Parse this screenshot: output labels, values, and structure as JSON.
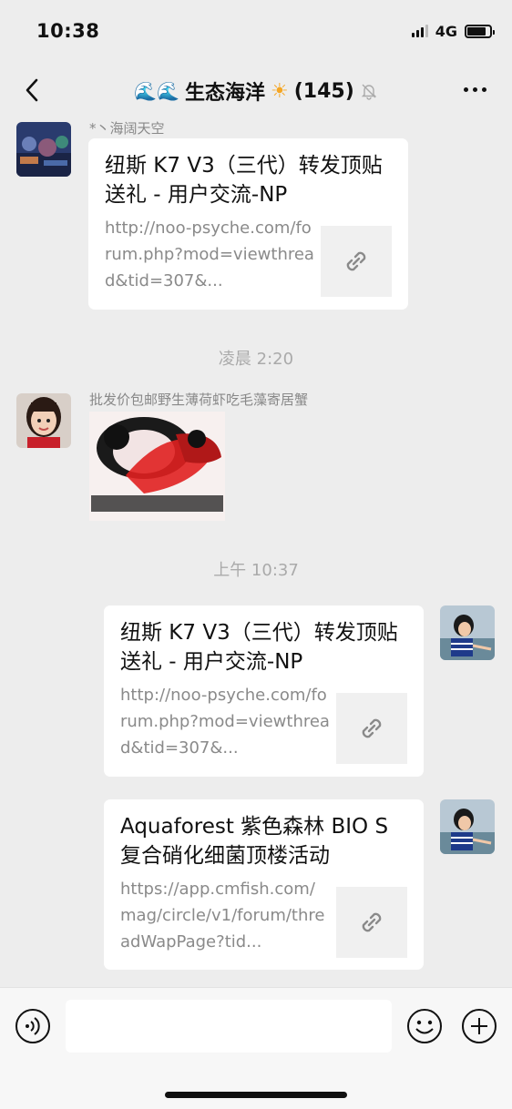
{
  "status": {
    "time": "10:38",
    "network": "4G",
    "battery_level": 0.85
  },
  "header": {
    "title_prefix": "🌊🌊",
    "title": "生态海洋",
    "title_suffix": "☀",
    "member_count": "(145)"
  },
  "messages": [
    {
      "sender": "*丶海阔天空",
      "card_title": "纽斯 K7 V3（三代）转发顶贴送礼 - 用户交流-NP",
      "card_desc": "http://noo-psyche.com/forum.php?mod=viewthread&tid=307&..."
    },
    {
      "timestamp": "凌晨 2:20"
    },
    {
      "sender": "批发价包邮野生薄荷虾吃毛藻寄居蟹"
    },
    {
      "timestamp": "上午 10:37"
    },
    {
      "card_title": "纽斯 K7 V3（三代）转发顶贴送礼 - 用户交流-NP",
      "card_desc": "http://noo-psyche.com/forum.php?mod=viewthread&tid=307&..."
    },
    {
      "card_title": "Aquaforest 紫色森林 BIO S 复合硝化细菌顶楼活动",
      "card_desc": "https://app.cmfish.com/mag/circle/v1/forum/threadWapPage?tid..."
    }
  ],
  "colors": {
    "background": "#ededed",
    "bubble": "#ffffff",
    "secondary_text": "#8a8a8a"
  },
  "icons": [
    "back-icon",
    "mute-icon",
    "more-icon",
    "link-icon",
    "voice-icon",
    "emoji-icon",
    "plus-icon"
  ]
}
